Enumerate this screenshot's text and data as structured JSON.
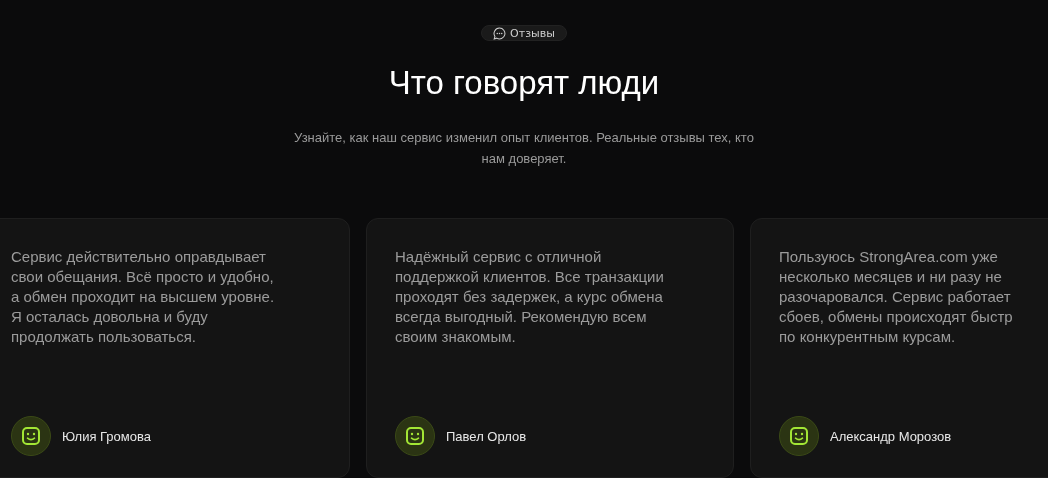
{
  "badge": {
    "label": "Отзывы"
  },
  "heading": "Что говорят люди",
  "subtitle": "Узнайте, как наш сервис изменил опыт клиентов. Реальные отзывы тех, кто нам доверяет.",
  "reviews": [
    {
      "lines": [
        "Сервис действительно оправдывает",
        "свои обещания. Всё просто и удобно,",
        "а обмен проходит на высшем уровне.",
        "Я осталась довольна и буду",
        "продолжать пользоваться."
      ],
      "author": "Юлия Громова"
    },
    {
      "lines": [
        "Надёжный сервис с отличной",
        "поддержкой клиентов. Все транзакции",
        "проходят без задержек, а курс обмена",
        "всегда выгодный. Рекомендую всем",
        "своим знакомым."
      ],
      "author": "Павел Орлов"
    },
    {
      "lines": [
        "Пользуюсь StrongArea.com уже",
        "несколько месяцев и ни разу не",
        "разочаровался. Сервис работает",
        "сбоев, обмены происходят быстр",
        "по конкурентным курсам."
      ],
      "author": "Александр Морозов"
    }
  ]
}
